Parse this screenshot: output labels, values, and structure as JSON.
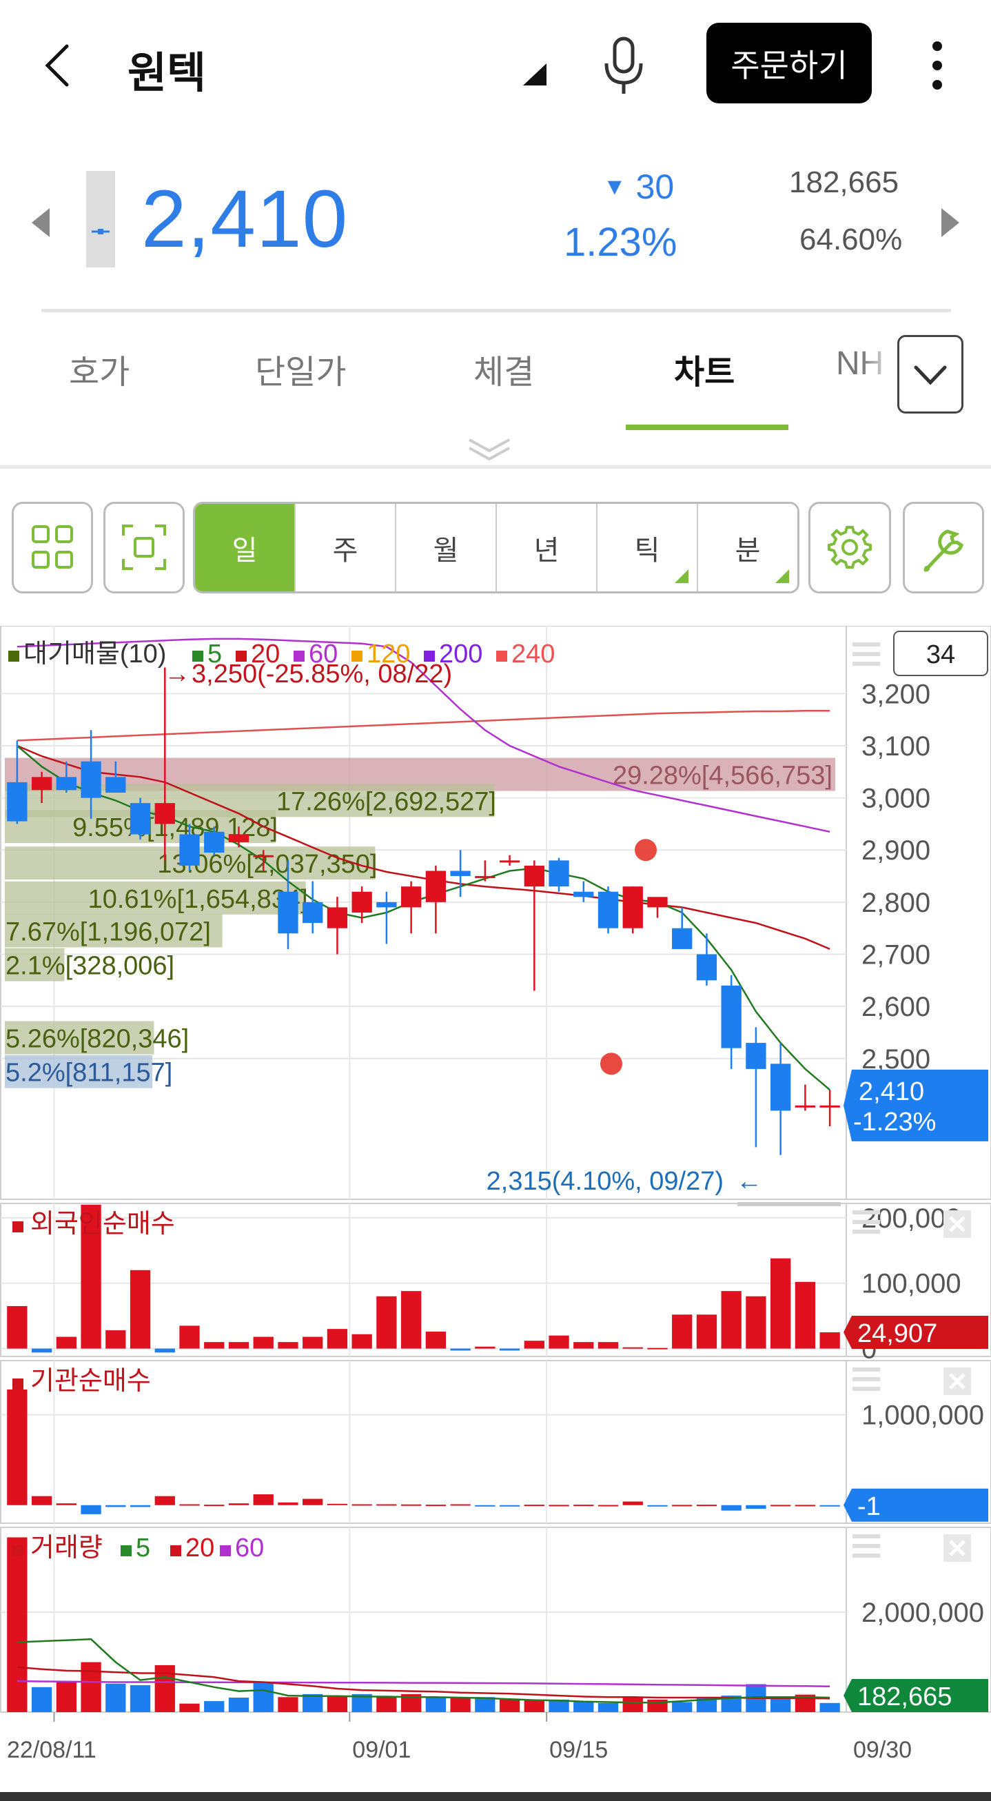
{
  "header": {
    "title": "원텍",
    "order_label": "주문하기"
  },
  "quote": {
    "price": "2,410",
    "change": "30",
    "change_pct": "1.23%",
    "volume": "182,665",
    "volume_pct": "64.60%"
  },
  "tabs": [
    "호가",
    "단일가",
    "체결",
    "차트",
    "NH"
  ],
  "active_tab": "차트",
  "periods": [
    {
      "label": "일",
      "active": true,
      "submenu": false
    },
    {
      "label": "주",
      "active": false,
      "submenu": false
    },
    {
      "label": "월",
      "active": false,
      "submenu": false
    },
    {
      "label": "년",
      "active": false,
      "submenu": false
    },
    {
      "label": "틱",
      "active": false,
      "submenu": true
    },
    {
      "label": "분",
      "active": false,
      "submenu": true
    }
  ],
  "colors": {
    "up": "#e0111f",
    "down": "#1d7ef0",
    "accent": "#7dbd3a",
    "price": "#2f7ee8"
  },
  "chart_data": {
    "type": "candlestick",
    "visible_count": "34",
    "legend": [
      {
        "label": "대기매물(10)",
        "color": "#4a6a0a"
      },
      {
        "label": "5",
        "color": "#2a8a2a"
      },
      {
        "label": "20",
        "color": "#d0141c"
      },
      {
        "label": "60",
        "color": "#b030d0"
      },
      {
        "label": "120",
        "color": "#f0a000"
      },
      {
        "label": "200",
        "color": "#8020e0"
      },
      {
        "label": "240",
        "color": "#f05050"
      }
    ],
    "ylim": [
      2230,
      3330
    ],
    "yticks": [
      "3,200",
      "3,100",
      "3,000",
      "2,900",
      "2,800",
      "2,700",
      "2,600",
      "2,500"
    ],
    "ytick_values": [
      3200,
      3100,
      3000,
      2900,
      2800,
      2700,
      2600,
      2500
    ],
    "x_labels": [
      "22/08/11",
      "09/01",
      "09/15",
      "09/30"
    ],
    "x_label_index": [
      2,
      14,
      22,
      34
    ],
    "candles": [
      [
        3030,
        3110,
        2950,
        2955
      ],
      [
        3015,
        3050,
        2990,
        3040
      ],
      [
        3040,
        3070,
        3010,
        3015
      ],
      [
        3070,
        3130,
        2960,
        3000
      ],
      [
        3040,
        3070,
        3020,
        3010
      ],
      [
        2990,
        3000,
        2920,
        2930
      ],
      [
        2950,
        3250,
        2880,
        2990
      ],
      [
        2930,
        2950,
        2860,
        2870
      ],
      [
        2935,
        2945,
        2890,
        2895
      ],
      [
        2915,
        2945,
        2905,
        2930
      ],
      [
        2890,
        2900,
        2860,
        2890
      ],
      [
        2820,
        2880,
        2710,
        2740
      ],
      [
        2800,
        2840,
        2740,
        2760
      ],
      [
        2750,
        2810,
        2700,
        2790
      ],
      [
        2780,
        2830,
        2760,
        2820
      ],
      [
        2800,
        2820,
        2720,
        2790
      ],
      [
        2790,
        2840,
        2740,
        2830
      ],
      [
        2800,
        2870,
        2740,
        2860
      ],
      [
        2860,
        2900,
        2810,
        2850
      ],
      [
        2850,
        2880,
        2840,
        2850
      ],
      [
        2880,
        2890,
        2870,
        2880
      ],
      [
        2830,
        2880,
        2630,
        2870
      ],
      [
        2880,
        2885,
        2820,
        2830
      ],
      [
        2820,
        2840,
        2800,
        2810
      ],
      [
        2820,
        2830,
        2740,
        2750
      ],
      [
        2750,
        2830,
        2740,
        2830
      ],
      [
        2790,
        2800,
        2770,
        2810
      ],
      [
        2750,
        2790,
        2730,
        2710
      ],
      [
        2700,
        2740,
        2640,
        2650
      ],
      [
        2640,
        2660,
        2480,
        2520
      ],
      [
        2530,
        2560,
        2330,
        2480
      ],
      [
        2490,
        2530,
        2315,
        2400
      ],
      [
        2410,
        2450,
        2400,
        2410
      ],
      [
        2410,
        2440,
        2370,
        2410
      ]
    ],
    "ma5": [
      3100,
      3060,
      3030,
      3010,
      2995,
      2975,
      2965,
      2945,
      2935,
      2910,
      2880,
      2840,
      2805,
      2780,
      2770,
      2780,
      2800,
      2815,
      2830,
      2845,
      2860,
      2865,
      2855,
      2845,
      2820,
      2805,
      2800,
      2780,
      2730,
      2670,
      2590,
      2530,
      2480,
      2440
    ],
    "ma20": [
      3100,
      3080,
      3065,
      3050,
      3045,
      3040,
      3030,
      3010,
      2990,
      2970,
      2945,
      2925,
      2905,
      2885,
      2870,
      2858,
      2850,
      2842,
      2835,
      2830,
      2826,
      2822,
      2817,
      2812,
      2806,
      2800,
      2795,
      2790,
      2780,
      2770,
      2760,
      2745,
      2730,
      2710
    ],
    "ma60": [
      3290,
      3292,
      3294,
      3296,
      3298,
      3300,
      3302,
      3304,
      3305,
      3305,
      3304,
      3302,
      3300,
      3298,
      3296,
      3290,
      3260,
      3215,
      3170,
      3130,
      3100,
      3080,
      3060,
      3045,
      3030,
      3015,
      3005,
      2995,
      2985,
      2975,
      2965,
      2955,
      2945,
      2935
    ],
    "ma240": [
      3110,
      3112,
      3114,
      3116,
      3118,
      3120,
      3122,
      3124,
      3126,
      3128,
      3130,
      3132,
      3134,
      3136,
      3138,
      3140,
      3142,
      3144,
      3146,
      3148,
      3150,
      3152,
      3154,
      3156,
      3158,
      3160,
      3162,
      3163,
      3164,
      3165,
      3166,
      3166,
      3167,
      3167
    ],
    "volume_profile": [
      {
        "label": "29.28%[4,566,753]",
        "pct": 29.28,
        "price": 3045,
        "color": "#cc9aa0"
      },
      {
        "label": "17.26%[2,692,527]",
        "pct": 17.26,
        "price": 2995,
        "color": "#b8c298"
      },
      {
        "label": "9.55%[1,489,128]",
        "pct": 9.55,
        "price": 2945,
        "color": "#b8c298"
      },
      {
        "label": "13.06%[2,037,350]",
        "pct": 13.06,
        "price": 2875,
        "color": "#b8c298"
      },
      {
        "label": "10.61%[1,654,834]",
        "pct": 10.61,
        "price": 2808,
        "color": "#b8c298"
      },
      {
        "label": "7.67%[1,196,072]",
        "pct": 7.67,
        "price": 2745,
        "color": "#b8c298"
      },
      {
        "label": "2.1%[328,006]",
        "pct": 2.1,
        "price": 2680,
        "color": "#b8c298"
      },
      {
        "label": "5.26%[820,346]",
        "pct": 5.26,
        "price": 2540,
        "color": "#b8c298"
      },
      {
        "label": "5.2%[811,157]",
        "pct": 5.2,
        "price": 2475,
        "color": "#a8c0d8"
      }
    ],
    "high_note": "3,250(-25.85%, 08/22)",
    "low_note": "2,315(4.10%, 09/27)",
    "price_tag": [
      "2,410",
      "-1.23%"
    ],
    "panels": [
      {
        "title": "외국인순매수",
        "yticks": [
          "200,000",
          "100,000",
          "0"
        ],
        "ytick_values": [
          200000,
          100000,
          0
        ],
        "ylim": [
          -12000,
          222000
        ],
        "last": "24,907",
        "tag_color": "#d0141c",
        "values": [
          65000,
          -6000,
          18000,
          220000,
          28000,
          120000,
          -6000,
          35000,
          10000,
          10000,
          18000,
          10000,
          18000,
          30000,
          22000,
          80000,
          88000,
          26000,
          -3000,
          3000,
          -3000,
          12000,
          20000,
          10000,
          10000,
          2000,
          1000,
          52000,
          52000,
          88000,
          80000,
          138000,
          102000,
          24907
        ]
      },
      {
        "title": "기관순매수",
        "yticks": [
          "1,000,000"
        ],
        "ytick_values": [
          1000000
        ],
        "ylim": [
          -200000,
          1600000
        ],
        "last": "-1",
        "tag_color": "#1d7ef0",
        "values": [
          1280000,
          100000,
          20000,
          -100000,
          -20000,
          -20000,
          100000,
          10000,
          5000,
          20000,
          120000,
          30000,
          70000,
          15000,
          10000,
          10000,
          8000,
          5000,
          10000,
          -15000,
          -15000,
          5000,
          3000,
          5000,
          2000,
          40000,
          -5000,
          3000,
          5000,
          -60000,
          -40000,
          3000,
          3000,
          -1
        ]
      },
      {
        "title": "거래량",
        "legend": [
          {
            "label": "5",
            "color": "#2a8a2a"
          },
          {
            "label": "20",
            "color": "#d0141c"
          },
          {
            "label": "60",
            "color": "#b030d0"
          }
        ],
        "yticks": [
          "2,000,000"
        ],
        "ytick_values": [
          2000000
        ],
        "ylim": [
          0,
          3700000
        ],
        "last": "182,665",
        "tag_color": "#10883c",
        "values": [
          3500000,
          500000,
          620000,
          1000000,
          570000,
          540000,
          940000,
          170000,
          220000,
          290000,
          600000,
          300000,
          360000,
          330000,
          360000,
          300000,
          360000,
          300000,
          290000,
          300000,
          270000,
          240000,
          250000,
          200000,
          180000,
          300000,
          250000,
          200000,
          300000,
          330000,
          560000,
          300000,
          350000,
          182665
        ],
        "up": [
          true,
          false,
          true,
          true,
          false,
          false,
          true,
          true,
          false,
          false,
          false,
          true,
          false,
          true,
          false,
          true,
          true,
          false,
          true,
          false,
          true,
          true,
          false,
          false,
          false,
          true,
          true,
          false,
          false,
          false,
          false,
          false,
          true,
          false
        ],
        "ma5": [
          1400000,
          1420000,
          1440000,
          1460000,
          1000000,
          640000,
          700000,
          600000,
          500000,
          420000,
          440000,
          330000,
          320000,
          320000,
          310000,
          310000,
          300000,
          300000,
          290000,
          280000,
          260000,
          240000,
          230000,
          210000,
          200000,
          190000,
          190000,
          220000,
          250000,
          280000,
          300000,
          300000,
          300000,
          290000
        ],
        "ma20": [
          900000,
          860000,
          830000,
          820000,
          800000,
          780000,
          780000,
          740000,
          700000,
          620000,
          600000,
          560000,
          520000,
          470000,
          440000,
          430000,
          420000,
          410000,
          390000,
          380000,
          370000,
          350000,
          330000,
          310000,
          300000,
          300000,
          290000,
          290000,
          290000,
          290000,
          280000,
          280000,
          280000,
          270000
        ],
        "ma60": [
          620000,
          615000,
          610000,
          605000,
          600000,
          600000,
          600000,
          598000,
          596000,
          595000,
          595000,
          594000,
          592000,
          590000,
          590000,
          588000,
          586000,
          585000,
          582000,
          580000,
          578000,
          575000,
          570000,
          565000,
          560000,
          555000,
          550000,
          545000,
          540000,
          535000,
          530000,
          525000,
          520000,
          515000
        ]
      }
    ]
  }
}
